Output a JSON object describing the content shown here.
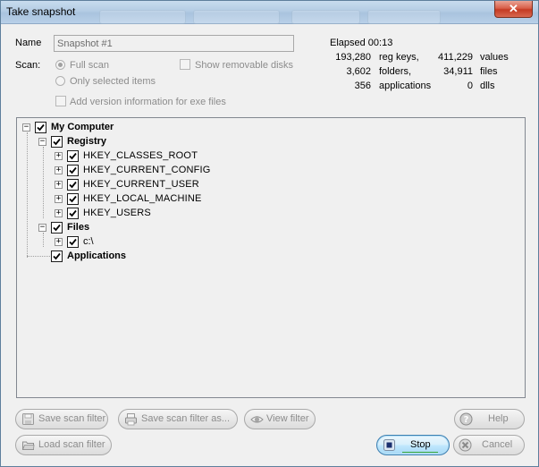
{
  "window": {
    "title": "Take snapshot",
    "close_glyph": "✕"
  },
  "form": {
    "name_label": "Name",
    "name_value": "Snapshot #1",
    "scan_label": "Scan:",
    "full_scan": "Full scan",
    "only_selected": "Only selected items",
    "show_removable": "Show removable disks",
    "add_version": "Add version information for exe files"
  },
  "stats": {
    "elapsed": "Elapsed 00:13",
    "reg_keys_num": "193,280",
    "reg_keys_label": "reg keys,",
    "values_num": "411,229",
    "values_label": "values",
    "folders_num": "3,602",
    "folders_label": "folders,",
    "files_num": "34,911",
    "files_label": "files",
    "apps_num": "356",
    "apps_label": "applications",
    "dlls_num": "0",
    "dlls_label": "dlls"
  },
  "tree": {
    "root": "My Computer",
    "registry": "Registry",
    "hkcr": "HKEY_CLASSES_ROOT",
    "hkcc": "HKEY_CURRENT_CONFIG",
    "hkcu": "HKEY_CURRENT_USER",
    "hklm": "HKEY_LOCAL_MACHINE",
    "hku": "HKEY_USERS",
    "files": "Files",
    "c_drive": "c:\\",
    "applications": "Applications"
  },
  "buttons": {
    "save_filter": "Save scan filter",
    "save_filter_as": "Save scan filter as...",
    "view_filter": "View filter",
    "help": "Help",
    "load_filter": "Load scan filter",
    "stop": "Stop",
    "cancel": "Cancel"
  },
  "icons": {
    "expand": "⊞",
    "collapse": "⊟"
  },
  "colors": {
    "titlebar": "#b4cce4",
    "close": "#c43a22",
    "stop_accent": "#3c7fb1"
  }
}
